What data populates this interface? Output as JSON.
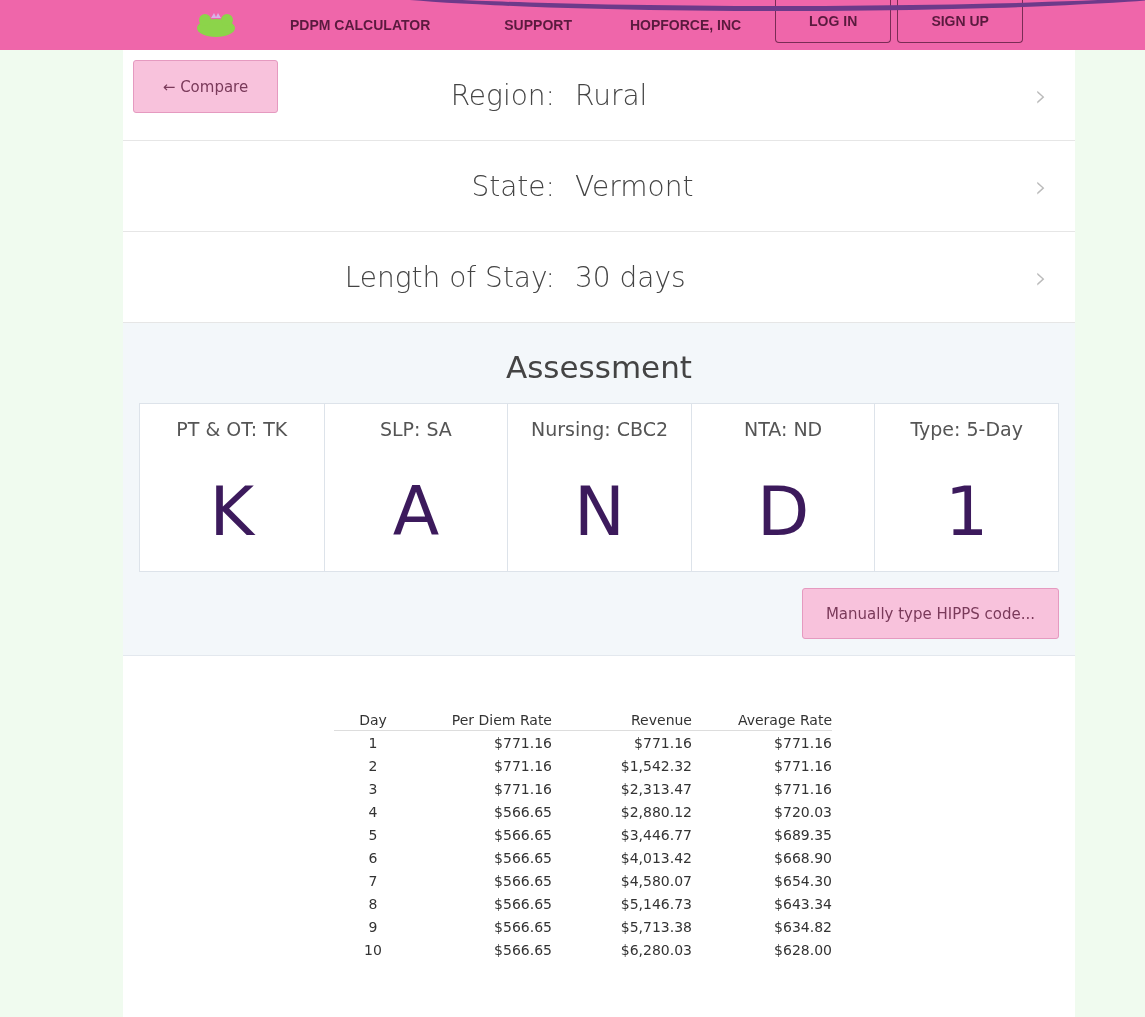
{
  "nav": {
    "links": [
      "PDPM CALCULATOR",
      "SUPPORT",
      "HOPFORCE, INC"
    ],
    "buttons": [
      "LOG IN",
      "SIGN UP"
    ]
  },
  "compare_button": "← Compare",
  "selectors": [
    {
      "label": "Region:",
      "value": "Rural",
      "chevron": "›"
    },
    {
      "label": "State:",
      "value": "Vermont",
      "chevron": "›"
    },
    {
      "label": "Length of Stay:",
      "value": "30 days",
      "chevron": "›"
    }
  ],
  "assessment": {
    "title": "Assessment",
    "components": [
      {
        "label": "PT & OT: TK",
        "code": "K"
      },
      {
        "label": "SLP: SA",
        "code": "A"
      },
      {
        "label": "Nursing: CBC2",
        "code": "N"
      },
      {
        "label": "NTA: ND",
        "code": "D"
      },
      {
        "label": "Type: 5-Day",
        "code": "1"
      }
    ],
    "manual_button": "Manually type HIPPS code..."
  },
  "table": {
    "columns": [
      "Day",
      "Per Diem Rate",
      "Revenue",
      "Average Rate"
    ],
    "rows": [
      [
        "1",
        "$771.16",
        "$771.16",
        "$771.16"
      ],
      [
        "2",
        "$771.16",
        "$1,542.32",
        "$771.16"
      ],
      [
        "3",
        "$771.16",
        "$2,313.47",
        "$771.16"
      ],
      [
        "4",
        "$566.65",
        "$2,880.12",
        "$720.03"
      ],
      [
        "5",
        "$566.65",
        "$3,446.77",
        "$689.35"
      ],
      [
        "6",
        "$566.65",
        "$4,013.42",
        "$668.90"
      ],
      [
        "7",
        "$566.65",
        "$4,580.07",
        "$654.30"
      ],
      [
        "8",
        "$566.65",
        "$5,146.73",
        "$643.34"
      ],
      [
        "9",
        "$566.65",
        "$5,713.38",
        "$634.82"
      ],
      [
        "10",
        "$566.65",
        "$6,280.03",
        "$628.00"
      ]
    ]
  }
}
